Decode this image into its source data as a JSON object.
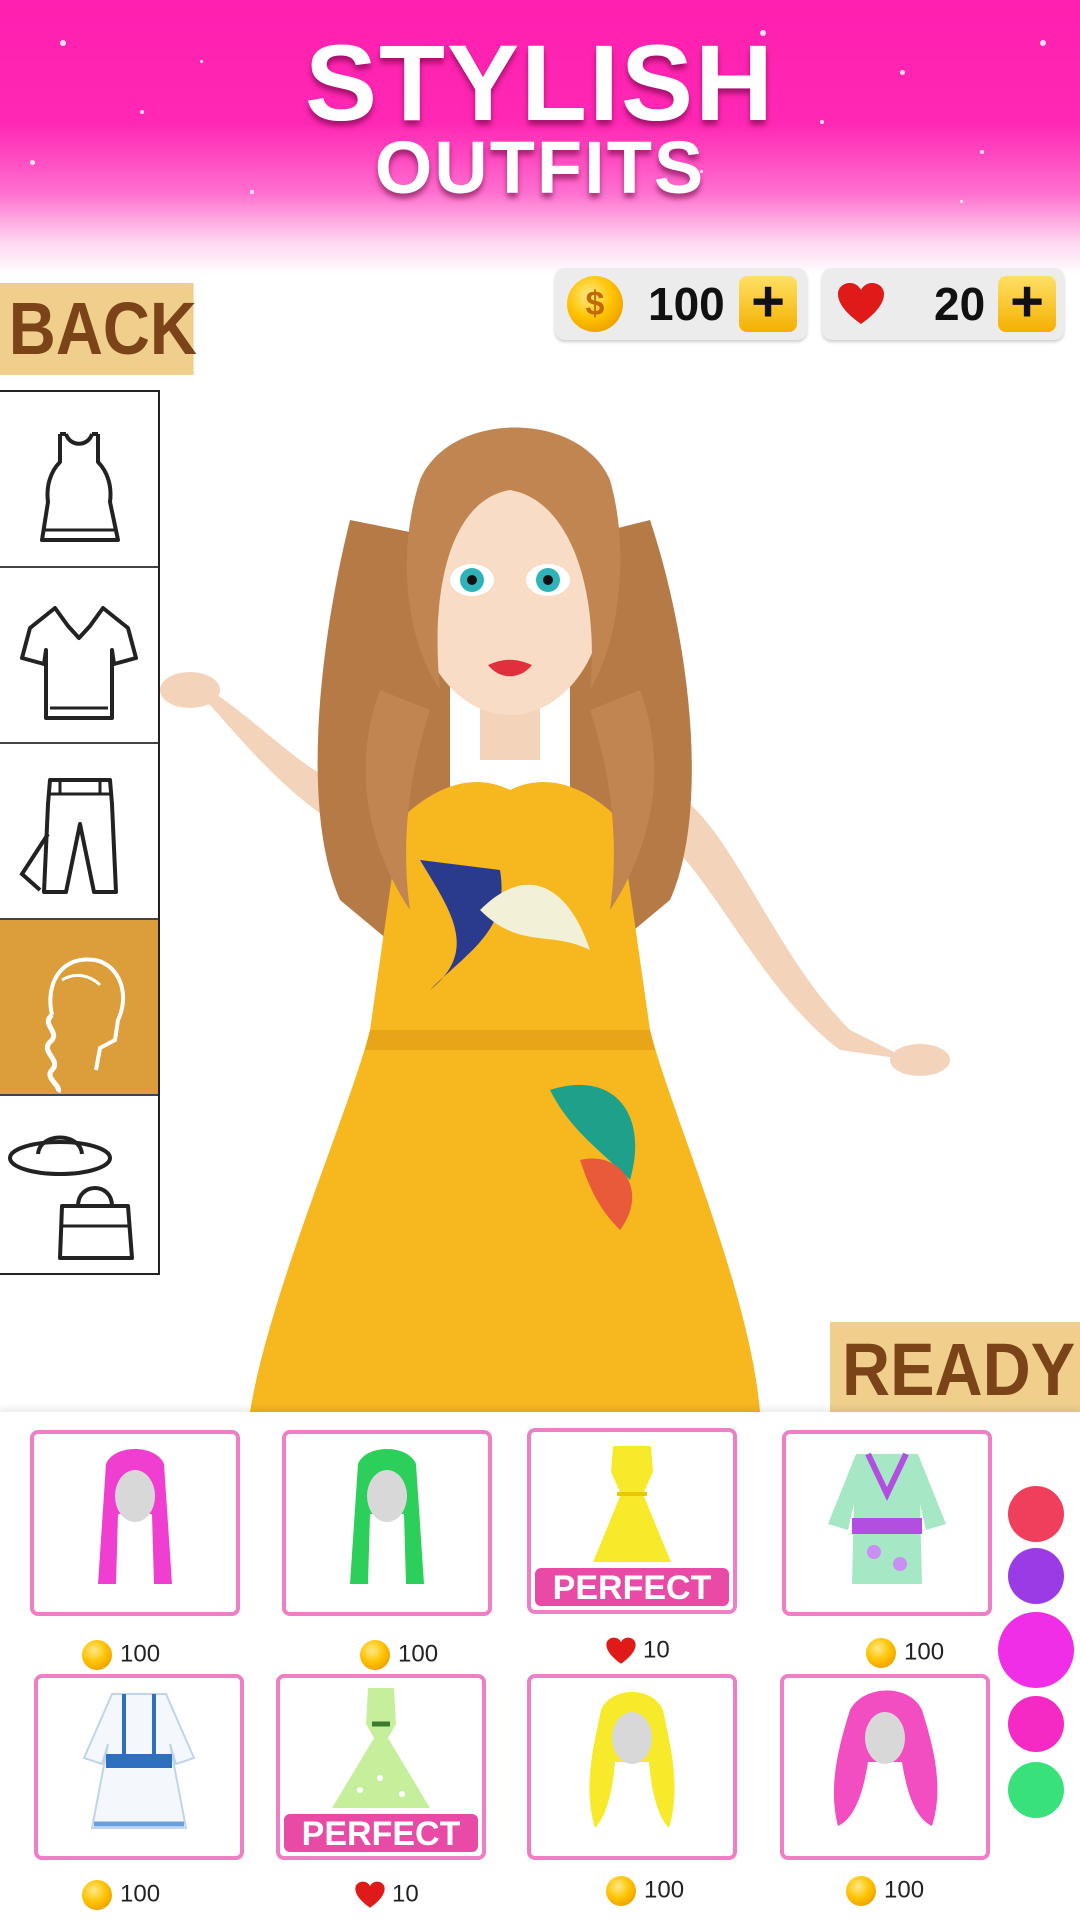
{
  "banner": {
    "title_line1": "STYLISH",
    "title_line2": "OUTFITS"
  },
  "back_button": {
    "label": "BACK"
  },
  "currency": {
    "coins": {
      "value": "100",
      "plus": "+"
    },
    "hearts": {
      "value": "20",
      "plus": "+"
    }
  },
  "categories": [
    {
      "name": "dress-icon",
      "active": false
    },
    {
      "name": "shirt-icon",
      "active": false
    },
    {
      "name": "pants-icon",
      "active": false
    },
    {
      "name": "hairstyle-icon",
      "active": true
    },
    {
      "name": "hat-bag-icon",
      "active": false
    }
  ],
  "ready_button": {
    "label": "READY"
  },
  "items": [
    {
      "name": "pink-wig",
      "price": "100",
      "currency": "coin",
      "badge": ""
    },
    {
      "name": "green-wig",
      "price": "100",
      "currency": "coin",
      "badge": ""
    },
    {
      "name": "yellow-dress",
      "price": "10",
      "currency": "heart",
      "badge": "PERFECT"
    },
    {
      "name": "floral-kimono-dress",
      "price": "100",
      "currency": "coin",
      "badge": ""
    },
    {
      "name": "white-blue-dress",
      "price": "100",
      "currency": "coin",
      "badge": ""
    },
    {
      "name": "green-dotted-dress",
      "price": "10",
      "currency": "heart",
      "badge": "PERFECT"
    },
    {
      "name": "yellow-wavy-wig",
      "price": "100",
      "currency": "coin",
      "badge": ""
    },
    {
      "name": "pink-curly-wig",
      "price": "100",
      "currency": "coin",
      "badge": ""
    }
  ],
  "color_swatches": [
    "#ef3f5c",
    "#9a3be6",
    "#f02ee8",
    "#f52ac4",
    "#38e17a"
  ],
  "colors": {
    "banner": "#ff1fb0",
    "button_bg": "#f0cf8d",
    "button_text": "#7a4318",
    "active_category": "#dc9e3a",
    "item_border": "#ef7fc4",
    "badge": "#e84aa5"
  }
}
